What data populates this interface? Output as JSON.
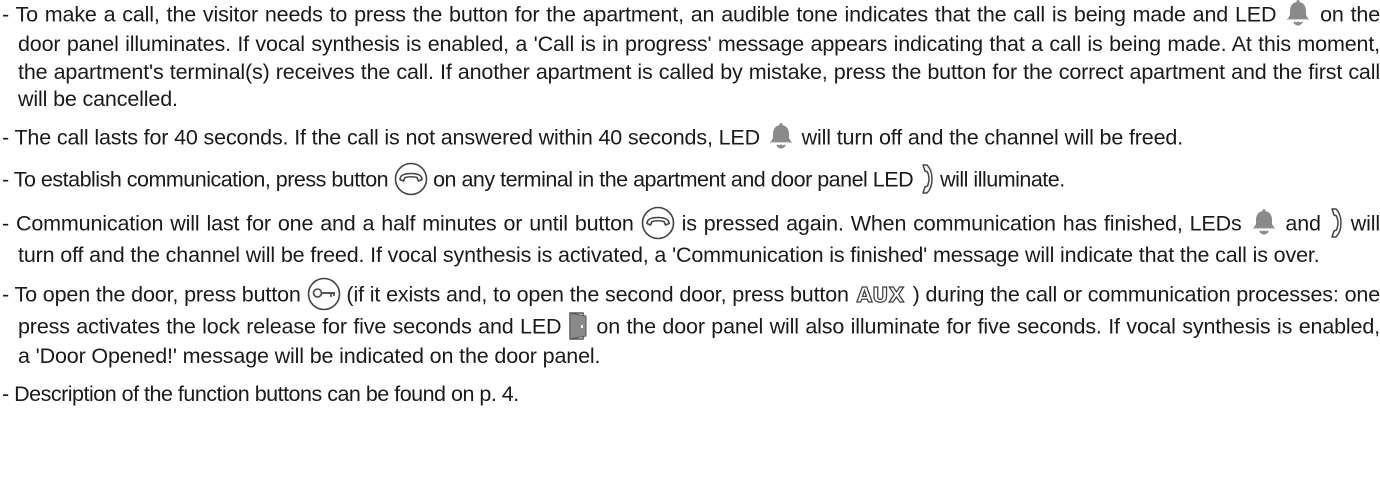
{
  "icons": {
    "bell": "bell-led-icon",
    "handset": "handset-led-icon",
    "call_button": "call-button-icon",
    "key_button": "key-button-icon",
    "door": "door-led-icon"
  },
  "aux_label": "AUX",
  "items": [
    {
      "segments": [
        "- To make a call, the visitor needs to press the button for the apartment, an audible tone indicates that the call is being made and LED ",
        " on the door panel illuminates. If vocal synthesis is enabled, a 'Call is in progress' message appears indicating that a call is being made. At this moment, the apartment's terminal(s) receives the call. If another apartment is called by mistake, press the button for the correct apartment and the first call will be cancelled."
      ]
    },
    {
      "segments": [
        "- The call lasts for 40 seconds. If the call is not answered within 40 seconds, LED ",
        " will turn off and the channel will be freed."
      ]
    },
    {
      "segments": [
        "- To establish communication, press button ",
        " on any terminal in the apartment and door panel LED ",
        " will illuminate."
      ]
    },
    {
      "segments": [
        "- Communication will last for one and a half minutes or until button ",
        " is pressed again. When communication has finished, LEDs ",
        " and ",
        " will turn off and the channel will be freed. If vocal synthesis is activated, a 'Communication is finished' message will indicate that the call is over."
      ]
    },
    {
      "segments": [
        "- To open the door, press button ",
        " (if it exists and, to open the second door, press button ",
        " ) during the call or communication processes: one press activates the lock release for five seconds and LED ",
        " on the door panel will also illuminate for five seconds. If vocal synthesis is enabled, a 'Door Opened!' message will be indicated on the door panel."
      ]
    },
    {
      "segments": [
        "- Description of the function buttons can be found on p. 4."
      ]
    }
  ]
}
